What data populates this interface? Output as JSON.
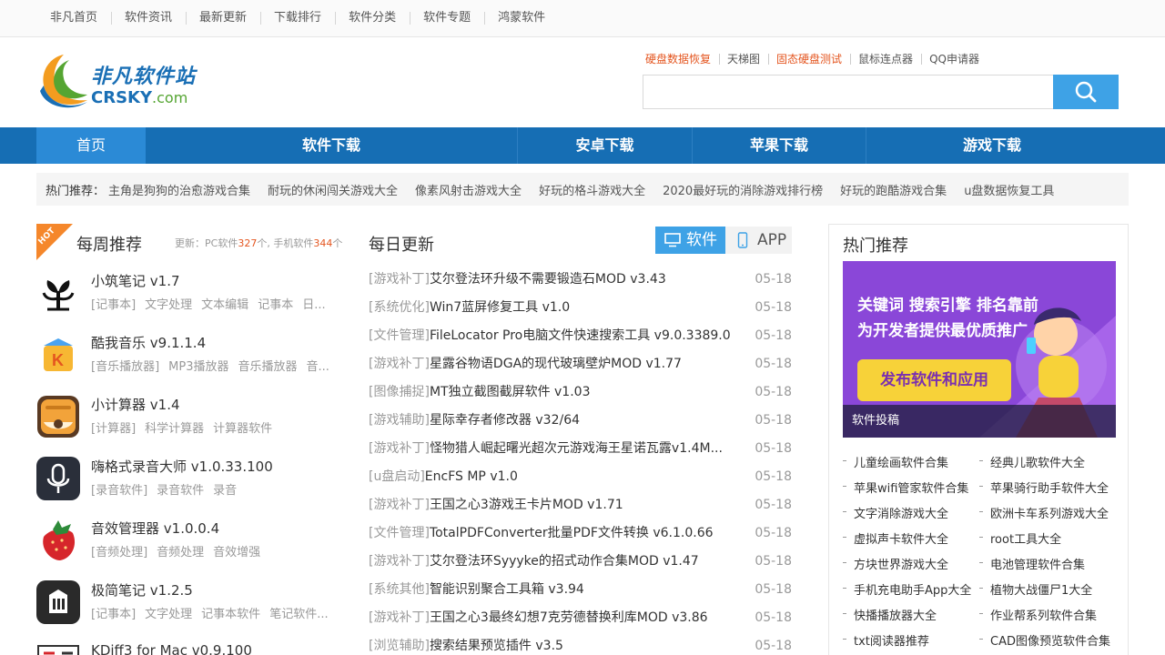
{
  "topnav": [
    "非凡首页",
    "软件资讯",
    "最新更新",
    "下载排行",
    "软件分类",
    "软件专题",
    "鸿蒙软件"
  ],
  "logo": {
    "cn": "非凡软件站",
    "en_main": "CRSKY",
    "en_dot": ".com"
  },
  "hotlinks": [
    {
      "text": "硬盘数据恢复",
      "color": "#e4551f"
    },
    {
      "text": "天梯图",
      "color": "#555555"
    },
    {
      "text": "固态硬盘测试",
      "color": "#e4551f"
    },
    {
      "text": "鼠标连点器",
      "color": "#555555"
    },
    {
      "text": "QQ申请器",
      "color": "#555555"
    }
  ],
  "search": {
    "value": "",
    "icon": "search-icon"
  },
  "mainnav": [
    "首页",
    "软件下载",
    "安卓下载",
    "苹果下载",
    "游戏下载"
  ],
  "hotbar": {
    "label": "热门推荐：",
    "items": [
      "主角是狗狗的治愈游戏合集",
      "耐玩的休闲闯关游戏大全",
      "像素风射击游戏大全",
      "好玩的格斗游戏大全",
      "2020最好玩的消除游戏排行榜",
      "好玩的跑酷游戏合集",
      "u盘数据恢复工具"
    ]
  },
  "weekly": {
    "badge": "HOT",
    "title": "每周推荐",
    "sub_prefix": "更新：PC软件",
    "pc_count": "327",
    "sub_mid": "个, 手机软件",
    "mobile_count": "344",
    "sub_suffix": "个",
    "items": [
      {
        "name": "小筑笔记 v1.7",
        "tags": [
          "[记事本]",
          "文字处理",
          "文本编辑",
          "记事本",
          "日..."
        ],
        "icon": "tree-icon"
      },
      {
        "name": "酷我音乐 v9.1.1.4",
        "tags": [
          "[音乐播放器]",
          "MP3播放器",
          "音乐播放器",
          "音..."
        ],
        "icon": "kuwo-icon"
      },
      {
        "name": "小计算器 v1.4",
        "tags": [
          "[计算器]",
          "科学计算器",
          "计算器软件"
        ],
        "icon": "calculator-icon"
      },
      {
        "name": "嗨格式录音大师 v1.0.33.100",
        "tags": [
          "[录音软件]",
          "录音软件",
          "录音"
        ],
        "icon": "microphone-icon"
      },
      {
        "name": "音效管理器 v1.0.0.4",
        "tags": [
          "[音频处理]",
          "音频处理",
          "音效增强"
        ],
        "icon": "strawberry-icon"
      },
      {
        "name": "极简笔记 v1.2.5",
        "tags": [
          "[记事本]",
          "文字处理",
          "记事本软件",
          "笔记软件..."
        ],
        "icon": "notebook-icon"
      },
      {
        "name": "KDiff3 for Mac v0.9.100",
        "tags": [],
        "icon": "diff-icon"
      }
    ]
  },
  "daily": {
    "title": "每日更新",
    "tabs": {
      "software": "软件",
      "app": "APP"
    },
    "items": [
      {
        "cat": "[游戏补丁]",
        "title": "艾尔登法环升级不需要锻造石MOD v3.43",
        "date": "05-18"
      },
      {
        "cat": "[系统优化]",
        "title": "Win7蓝屏修复工具 v1.0",
        "date": "05-18"
      },
      {
        "cat": "[文件管理]",
        "title": "FileLocator Pro电脑文件快速搜索工具 v9.0.3389.0",
        "date": "05-18"
      },
      {
        "cat": "[游戏补丁]",
        "title": "星露谷物语DGA的现代玻璃壁炉MOD v1.77",
        "date": "05-18"
      },
      {
        "cat": "[图像捕捉]",
        "title": "MT独立截图截屏软件 v1.03",
        "date": "05-18"
      },
      {
        "cat": "[游戏辅助]",
        "title": "星际幸存者修改器 v32/64",
        "date": "05-18"
      },
      {
        "cat": "[游戏补丁]",
        "title": "怪物猎人崛起曙光超次元游戏海王星诺瓦露v1.4M...",
        "date": "05-18"
      },
      {
        "cat": "[u盘启动]",
        "title": "EncFS MP v1.0",
        "date": "05-18"
      },
      {
        "cat": "[游戏补丁]",
        "title": "王国之心3游戏王卡片MOD v1.71",
        "date": "05-18"
      },
      {
        "cat": "[文件管理]",
        "title": "TotalPDFConverter批量PDF文件转换 v6.1.0.66",
        "date": "05-18"
      },
      {
        "cat": "[游戏补丁]",
        "title": "艾尔登法环Syyyke的招式动作合集MOD v1.47",
        "date": "05-18"
      },
      {
        "cat": "[系统其他]",
        "title": "智能识别聚合工具箱 v3.94",
        "date": "05-18"
      },
      {
        "cat": "[游戏补丁]",
        "title": "王国之心3最终幻想7克劳德替换利库MOD v3.86",
        "date": "05-18"
      },
      {
        "cat": "[浏览辅助]",
        "title": "搜索结果预览插件 v3.5",
        "date": "05-18"
      }
    ]
  },
  "hotrec": {
    "title": "热门推荐",
    "banner": {
      "line1": "关键词  搜索引擎  排名靠前",
      "line2": "为开发者提供最优质推广",
      "cta": "发布软件和应用",
      "caption": "软件投稿"
    },
    "links": [
      [
        "儿童绘画软件合集",
        "经典儿歌软件大全"
      ],
      [
        "苹果wifi管家软件合集",
        "苹果骑行助手软件大全"
      ],
      [
        "文字消除游戏大全",
        "欧洲卡车系列游戏大全"
      ],
      [
        "虚拟声卡软件大全",
        "root工具大全"
      ],
      [
        "方块世界游戏大全",
        "电池管理软件合集"
      ],
      [
        "手机充电助手App大全",
        "植物大战僵尸1大全"
      ],
      [
        "快播播放器大全",
        "作业帮系列软件合集"
      ],
      [
        "txt阅读器推荐",
        "CAD图像预览软件合集"
      ]
    ]
  }
}
